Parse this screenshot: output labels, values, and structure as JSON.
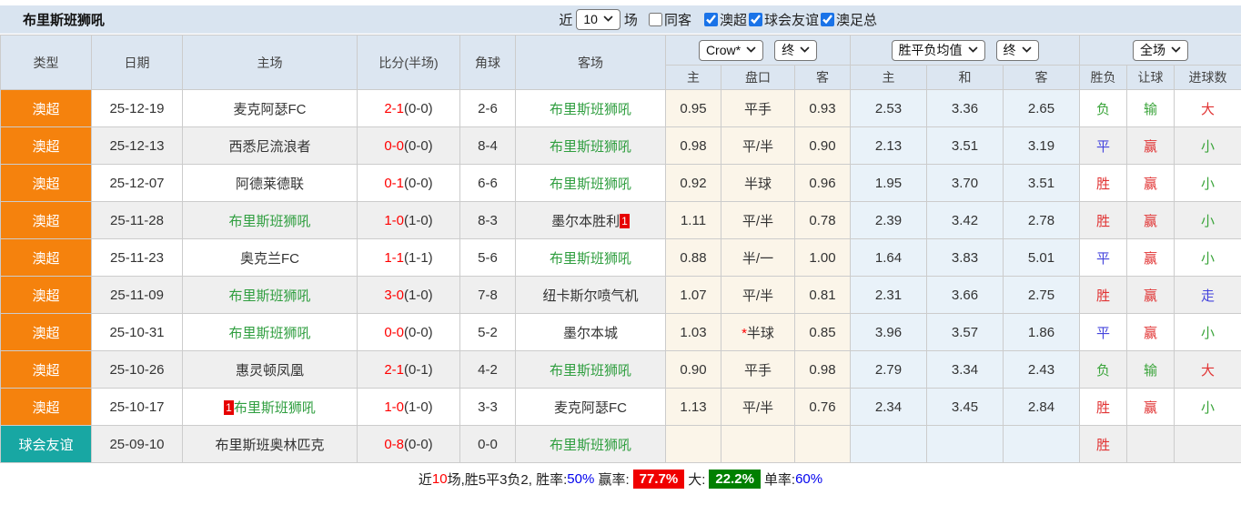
{
  "title": "布里斯班狮吼",
  "topbar": {
    "recent_label": "近",
    "recent_value": "10",
    "unit_label": "场",
    "filters": [
      {
        "label": "同客",
        "checked": false
      },
      {
        "label": "澳超",
        "checked": true
      },
      {
        "label": "球会友谊",
        "checked": true
      },
      {
        "label": "澳足总",
        "checked": true
      }
    ]
  },
  "table": {
    "left_headers": [
      "类型",
      "日期",
      "主场",
      "比分(半场)",
      "角球",
      "客场"
    ],
    "dropdowns": {
      "company": "Crow*",
      "asian_time": "终",
      "europe_type": "胜平负均值",
      "europe_time": "终",
      "scope": "全场"
    },
    "sub_headers": [
      "主",
      "盘口",
      "客",
      "主",
      "和",
      "客",
      "胜负",
      "让球",
      "进球数"
    ],
    "rows": [
      {
        "type": "澳超",
        "type_key": "league",
        "date": "25-12-19",
        "home": "麦克阿瑟FC",
        "home_green": false,
        "home_badge": "",
        "score_ft": "2-1",
        "score_ht": "(0-0)",
        "corner": "2-6",
        "away": "布里斯班狮吼",
        "away_green": true,
        "away_badge": "",
        "asian_home": "0.95",
        "handicap_star": "",
        "handicap": "平手",
        "asian_away": "0.93",
        "euro_home": "2.53",
        "euro_draw": "3.36",
        "euro_away": "2.65",
        "outcome": "负",
        "outcome_color": "green",
        "let_result": "输",
        "let_color": "green",
        "goal_result": "大",
        "goal_color": "red"
      },
      {
        "type": "澳超",
        "type_key": "league",
        "date": "25-12-13",
        "home": "西悉尼流浪者",
        "home_green": false,
        "home_badge": "",
        "score_ft": "0-0",
        "score_ht": "(0-0)",
        "corner": "8-4",
        "away": "布里斯班狮吼",
        "away_green": true,
        "away_badge": "",
        "asian_home": "0.98",
        "handicap_star": "",
        "handicap": "平/半",
        "asian_away": "0.90",
        "euro_home": "2.13",
        "euro_draw": "3.51",
        "euro_away": "3.19",
        "outcome": "平",
        "outcome_color": "blue",
        "let_result": "赢",
        "let_color": "red",
        "goal_result": "小",
        "goal_color": "green"
      },
      {
        "type": "澳超",
        "type_key": "league",
        "date": "25-12-07",
        "home": "阿德莱德联",
        "home_green": false,
        "home_badge": "",
        "score_ft": "0-1",
        "score_ht": "(0-0)",
        "corner": "6-6",
        "away": "布里斯班狮吼",
        "away_green": true,
        "away_badge": "",
        "asian_home": "0.92",
        "handicap_star": "",
        "handicap": "半球",
        "asian_away": "0.96",
        "euro_home": "1.95",
        "euro_draw": "3.70",
        "euro_away": "3.51",
        "outcome": "胜",
        "outcome_color": "red",
        "let_result": "赢",
        "let_color": "red",
        "goal_result": "小",
        "goal_color": "green"
      },
      {
        "type": "澳超",
        "type_key": "league",
        "date": "25-11-28",
        "home": "布里斯班狮吼",
        "home_green": true,
        "home_badge": "",
        "score_ft": "1-0",
        "score_ht": "(1-0)",
        "corner": "8-3",
        "away": "墨尔本胜利",
        "away_green": false,
        "away_badge": "1",
        "asian_home": "1.11",
        "handicap_star": "",
        "handicap": "平/半",
        "asian_away": "0.78",
        "euro_home": "2.39",
        "euro_draw": "3.42",
        "euro_away": "2.78",
        "outcome": "胜",
        "outcome_color": "red",
        "let_result": "赢",
        "let_color": "red",
        "goal_result": "小",
        "goal_color": "green"
      },
      {
        "type": "澳超",
        "type_key": "league",
        "date": "25-11-23",
        "home": "奥克兰FC",
        "home_green": false,
        "home_badge": "",
        "score_ft": "1-1",
        "score_ht": "(1-1)",
        "corner": "5-6",
        "away": "布里斯班狮吼",
        "away_green": true,
        "away_badge": "",
        "asian_home": "0.88",
        "handicap_star": "",
        "handicap": "半/一",
        "asian_away": "1.00",
        "euro_home": "1.64",
        "euro_draw": "3.83",
        "euro_away": "5.01",
        "outcome": "平",
        "outcome_color": "blue",
        "let_result": "赢",
        "let_color": "red",
        "goal_result": "小",
        "goal_color": "green"
      },
      {
        "type": "澳超",
        "type_key": "league",
        "date": "25-11-09",
        "home": "布里斯班狮吼",
        "home_green": true,
        "home_badge": "",
        "score_ft": "3-0",
        "score_ht": "(1-0)",
        "corner": "7-8",
        "away": "纽卡斯尔喷气机",
        "away_green": false,
        "away_badge": "",
        "asian_home": "1.07",
        "handicap_star": "",
        "handicap": "平/半",
        "asian_away": "0.81",
        "euro_home": "2.31",
        "euro_draw": "3.66",
        "euro_away": "2.75",
        "outcome": "胜",
        "outcome_color": "red",
        "let_result": "赢",
        "let_color": "red",
        "goal_result": "走",
        "goal_color": "blue"
      },
      {
        "type": "澳超",
        "type_key": "league",
        "date": "25-10-31",
        "home": "布里斯班狮吼",
        "home_green": true,
        "home_badge": "",
        "score_ft": "0-0",
        "score_ht": "(0-0)",
        "corner": "5-2",
        "away": "墨尔本城",
        "away_green": false,
        "away_badge": "",
        "asian_home": "1.03",
        "handicap_star": "*",
        "handicap": "半球",
        "asian_away": "0.85",
        "euro_home": "3.96",
        "euro_draw": "3.57",
        "euro_away": "1.86",
        "outcome": "平",
        "outcome_color": "blue",
        "let_result": "赢",
        "let_color": "red",
        "goal_result": "小",
        "goal_color": "green"
      },
      {
        "type": "澳超",
        "type_key": "league",
        "date": "25-10-26",
        "home": "惠灵顿凤凰",
        "home_green": false,
        "home_badge": "",
        "score_ft": "2-1",
        "score_ht": "(0-1)",
        "corner": "4-2",
        "away": "布里斯班狮吼",
        "away_green": true,
        "away_badge": "",
        "asian_home": "0.90",
        "handicap_star": "",
        "handicap": "平手",
        "asian_away": "0.98",
        "euro_home": "2.79",
        "euro_draw": "3.34",
        "euro_away": "2.43",
        "outcome": "负",
        "outcome_color": "green",
        "let_result": "输",
        "let_color": "green",
        "goal_result": "大",
        "goal_color": "red"
      },
      {
        "type": "澳超",
        "type_key": "league",
        "date": "25-10-17",
        "home": "布里斯班狮吼",
        "home_green": true,
        "home_badge": "1",
        "score_ft": "1-0",
        "score_ht": "(1-0)",
        "corner": "3-3",
        "away": "麦克阿瑟FC",
        "away_green": false,
        "away_badge": "",
        "asian_home": "1.13",
        "handicap_star": "",
        "handicap": "平/半",
        "asian_away": "0.76",
        "euro_home": "2.34",
        "euro_draw": "3.45",
        "euro_away": "2.84",
        "outcome": "胜",
        "outcome_color": "red",
        "let_result": "赢",
        "let_color": "red",
        "goal_result": "小",
        "goal_color": "green"
      },
      {
        "type": "球会友谊",
        "type_key": "friendly",
        "date": "25-09-10",
        "home": "布里斯班奥林匹克",
        "home_green": false,
        "home_badge": "",
        "score_ft": "0-8",
        "score_ht": "(0-0)",
        "corner": "0-0",
        "away": "布里斯班狮吼",
        "away_green": true,
        "away_badge": "",
        "asian_home": "",
        "handicap_star": "",
        "handicap": "",
        "asian_away": "",
        "euro_home": "",
        "euro_draw": "",
        "euro_away": "",
        "outcome": "胜",
        "outcome_color": "red",
        "let_result": "",
        "let_color": "",
        "goal_result": "",
        "goal_color": ""
      }
    ]
  },
  "footer": {
    "segments": [
      {
        "text": "近",
        "style": "plain"
      },
      {
        "text": "10",
        "style": "red"
      },
      {
        "text": "场,胜5平3负2, 胜率:",
        "style": "plain"
      },
      {
        "text": "50%",
        "style": "blue"
      },
      {
        "text": " 赢率:",
        "style": "plain"
      },
      {
        "text": "77.7%",
        "style": "badge-red"
      },
      {
        "text": "大:",
        "style": "plain"
      },
      {
        "text": "22.2%",
        "style": "badge-green"
      },
      {
        "text": "单率:",
        "style": "plain"
      },
      {
        "text": "60%",
        "style": "blue"
      }
    ]
  },
  "colors": {
    "league_orange": "#f5820d",
    "friendly_teal": "#18a7a3",
    "team_green": "#2f9e3f",
    "score_red": "#ff0000",
    "win_red": "#e13333",
    "draw_blue": "#4545dd",
    "lose_green": "#3aa43a",
    "header_blue": "#dce6f1"
  }
}
